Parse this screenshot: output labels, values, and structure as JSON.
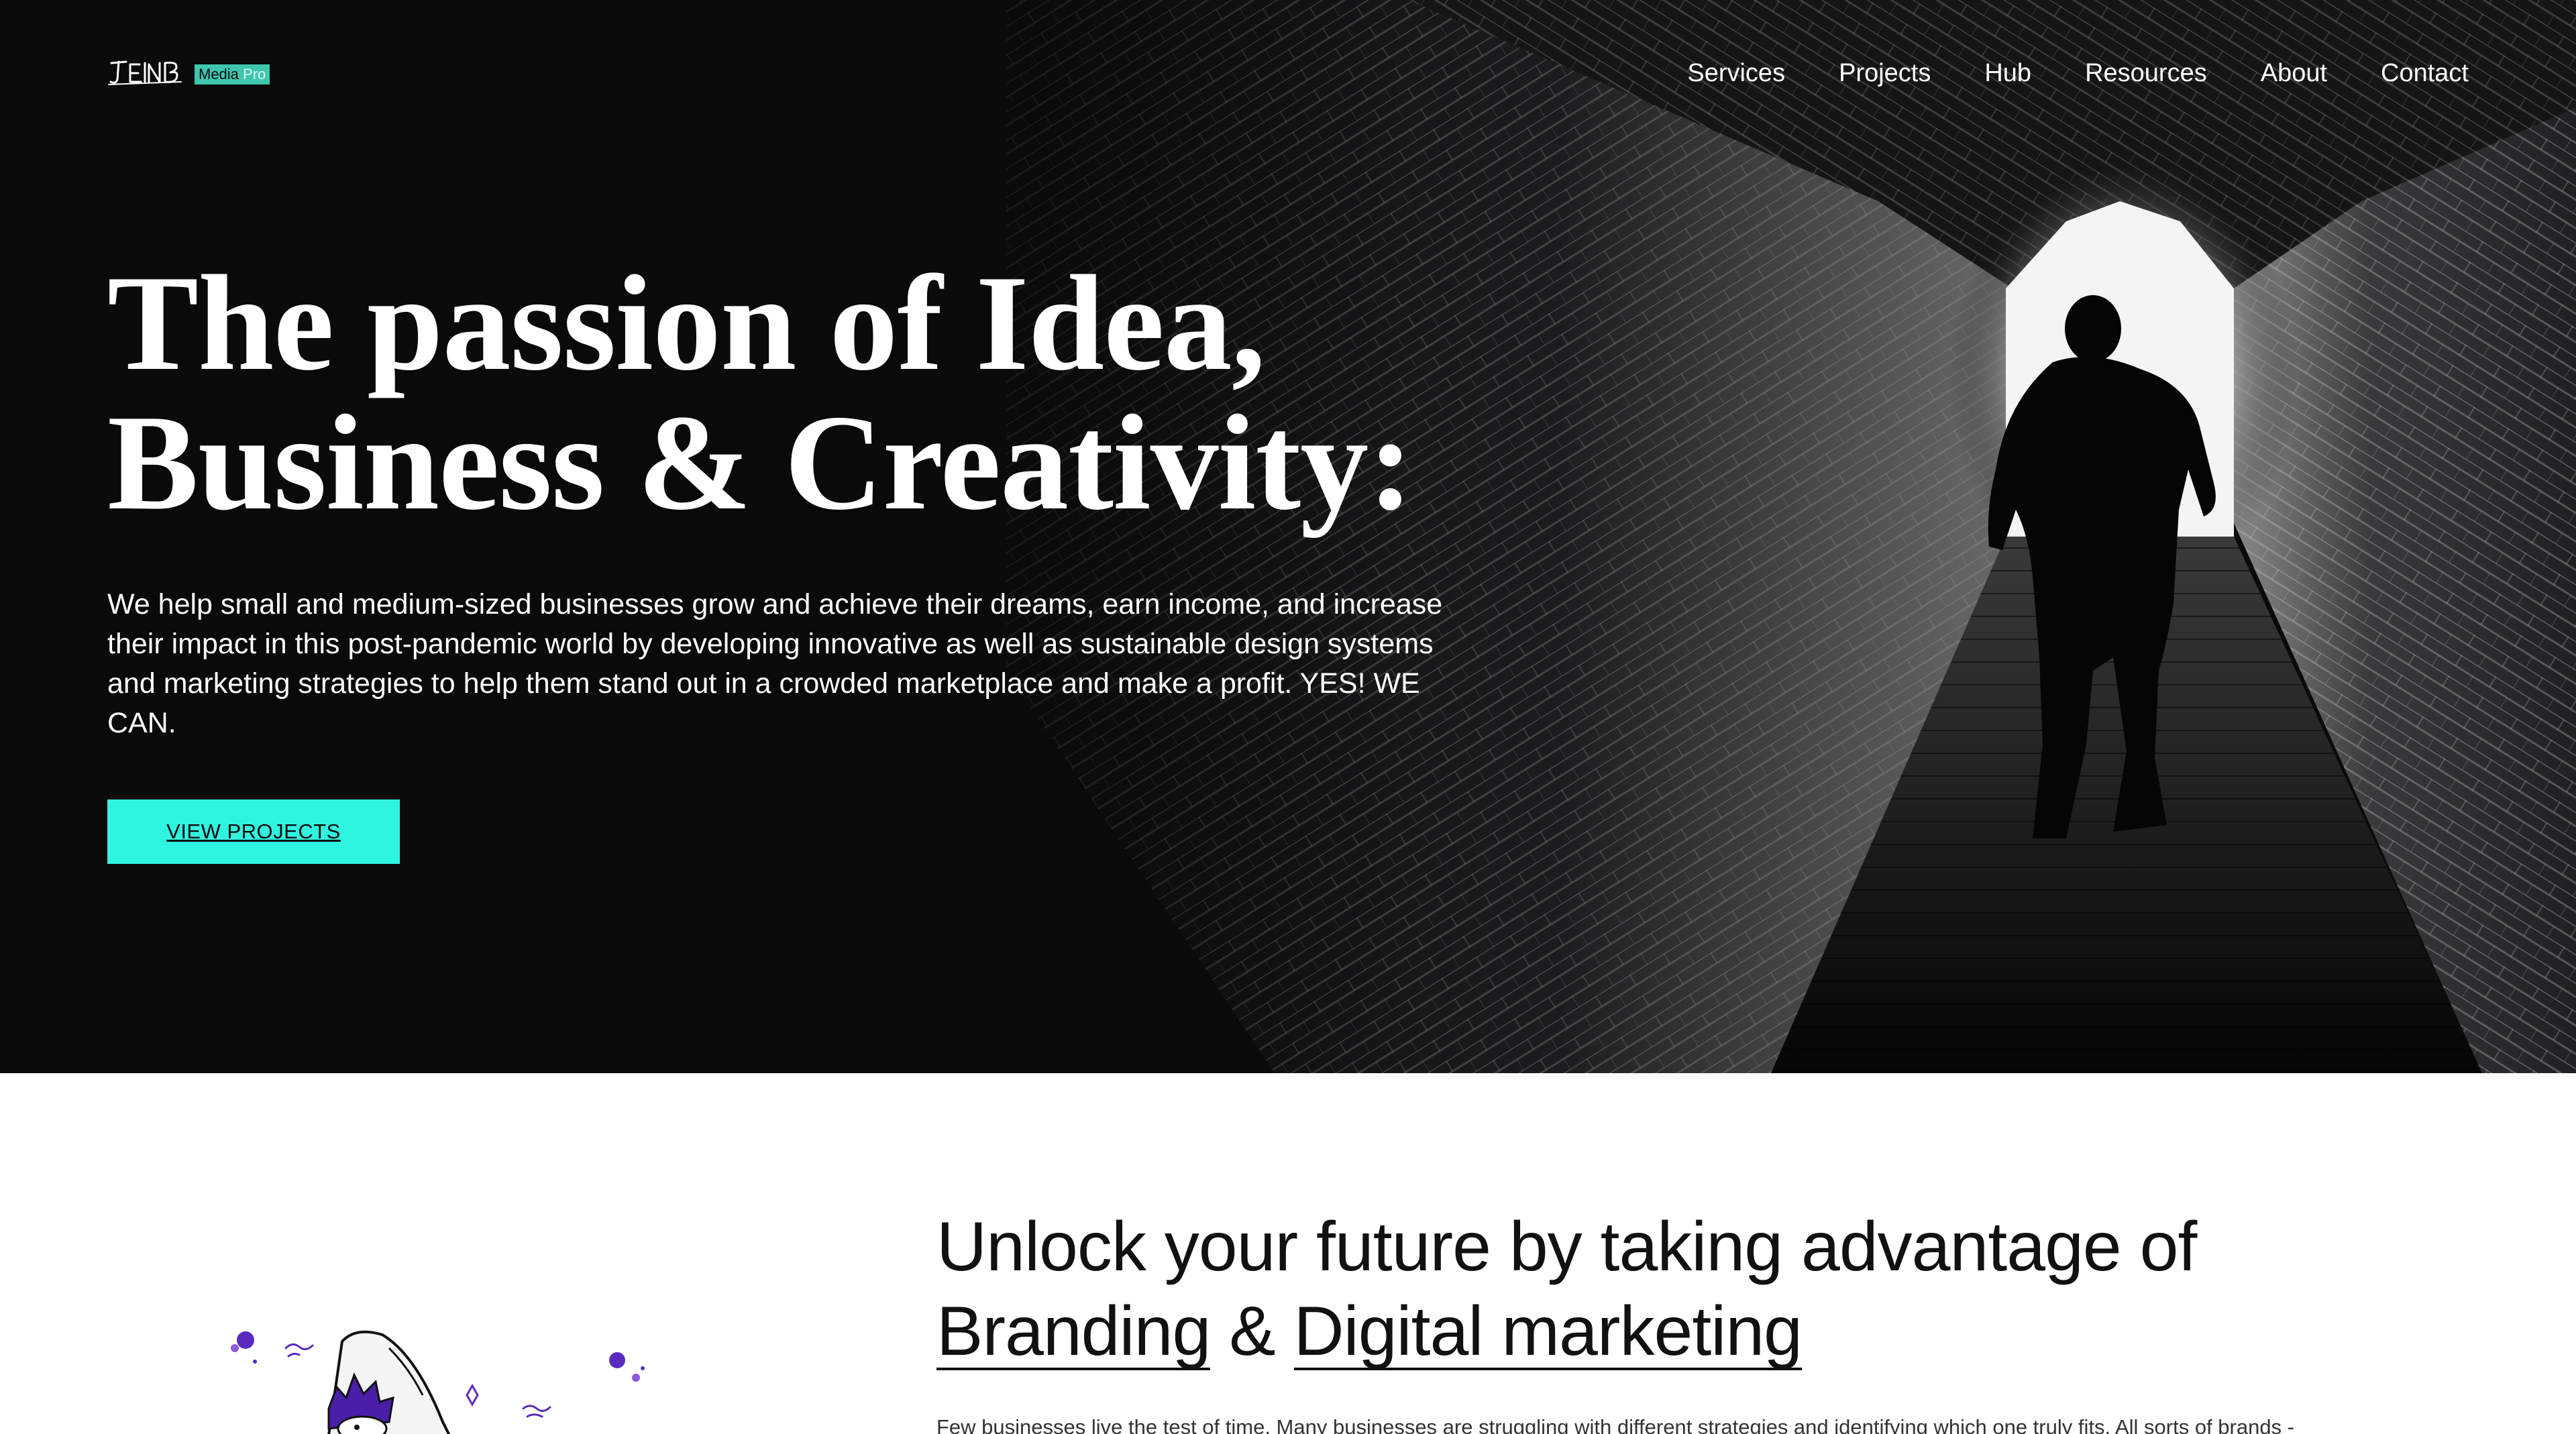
{
  "header": {
    "logo": {
      "wordmark": "JEINB",
      "badge_main": "Media",
      "badge_sub": "Pro"
    },
    "nav": [
      "Services",
      "Projects",
      "Hub",
      "Resources",
      "About",
      "Contact"
    ]
  },
  "hero": {
    "title_line1": "The passion of Idea,",
    "title_line2": "Business & Creativity:",
    "description": "We help small and medium-sized businesses grow and achieve their dreams, earn income, and increase their impact in this post-pandemic world by developing innovative as well as sustainable design systems and marketing strategies to help them stand out in a crowded marketplace and make a profit. YES! WE CAN.",
    "cta_label": "VIEW PROJECTS"
  },
  "section2": {
    "title_line1": "Unlock your future by taking advantage of",
    "title_branding": "Branding",
    "title_amp": "&",
    "title_digital": "Digital marketing",
    "body_excerpt": "Few businesses live the test of time. Many businesses are struggling with different strategies and identifying which one truly fits. All sorts of brands -"
  },
  "colors": {
    "hero_bg": "#0a0a0b",
    "accent_cta": "#2ff5e0",
    "logo_badge": "#3fc6ae",
    "illustration_purple": "#5b2bbf"
  },
  "icons": {
    "logo_script": "handwritten-logo-mark",
    "illustration": "rocket-character-illustration"
  }
}
